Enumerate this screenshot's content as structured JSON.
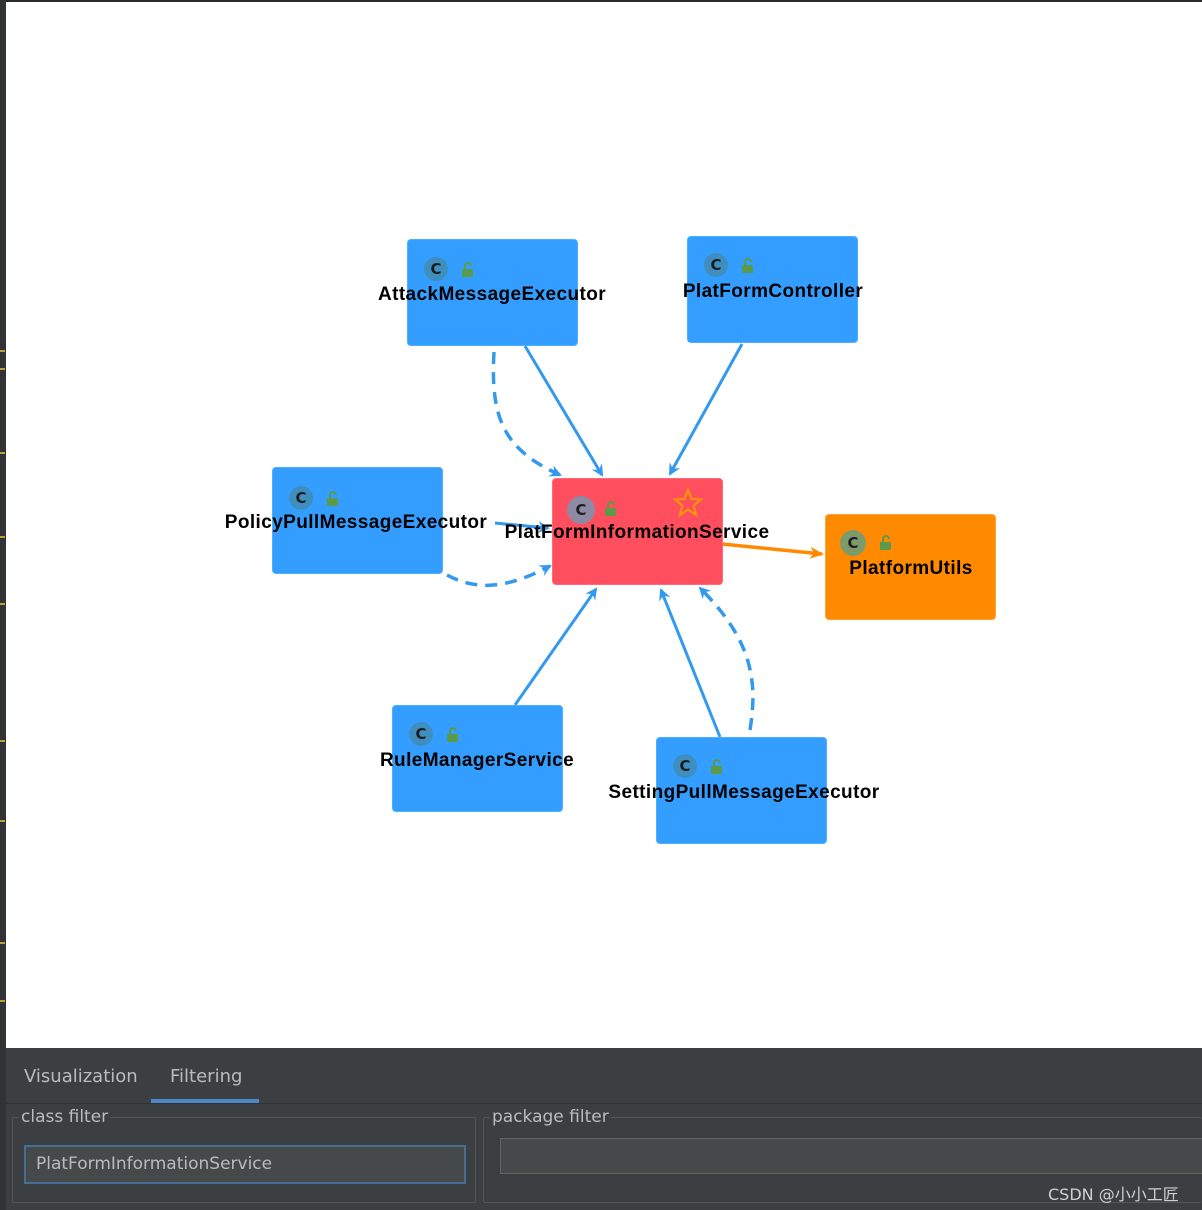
{
  "graph": {
    "nodes": {
      "attack": {
        "label": "AttackMessageExecutor",
        "icon": "class-icon",
        "icon_letter": "C"
      },
      "controller": {
        "label": "PlatFormController",
        "icon": "class-icon",
        "icon_letter": "C"
      },
      "policy": {
        "label": "PolicyPullMessageExecutor",
        "icon": "class-icon",
        "icon_letter": "C"
      },
      "service": {
        "label": "PlatFormInformationService",
        "icon": "class-icon",
        "icon_letter": "C"
      },
      "utils": {
        "label": "PlatformUtils",
        "icon": "class-icon",
        "icon_letter": "C"
      },
      "rule": {
        "label": "RuleManagerService",
        "icon": "class-icon",
        "icon_letter": "C"
      },
      "setting": {
        "label": "SettingPullMessageExecutor",
        "icon": "class-icon",
        "icon_letter": "C"
      }
    },
    "colors": {
      "dependent": "#339eff",
      "target": "#ff4f5e",
      "dependency": "#ff8a00",
      "edge": "#3399ee",
      "edge_out": "#ff8a00"
    }
  },
  "panel": {
    "tabs": [
      {
        "label": "Visualization"
      },
      {
        "label": "Filtering",
        "active": true
      }
    ],
    "class_filter": {
      "legend": "class filter",
      "value": "PlatFormInformationService"
    },
    "package_filter": {
      "legend": "package filter",
      "value": ""
    }
  },
  "watermark": "CSDN @小小工匠"
}
